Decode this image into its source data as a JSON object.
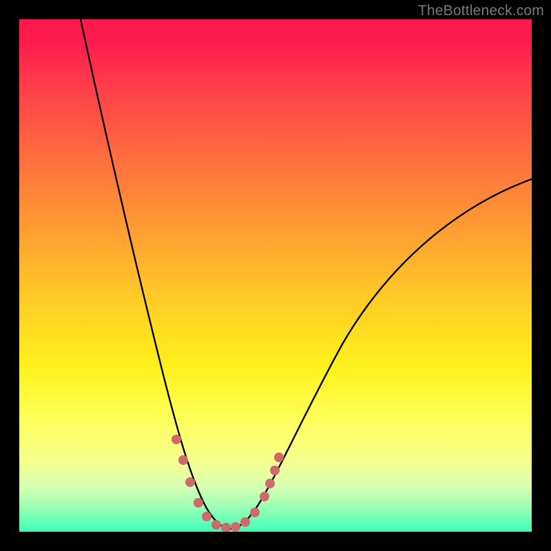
{
  "watermark": "TheBottleneck.com",
  "curve_color": "#000000",
  "marker_color": "#cf6a6a",
  "chart_data": {
    "type": "line",
    "title": "",
    "xlabel": "",
    "ylabel": "",
    "xlim": [
      0,
      100
    ],
    "ylim": [
      0,
      100
    ],
    "grid": false,
    "legend": false,
    "series": [
      {
        "name": "bottleneck-curve-left",
        "x": [
          12,
          14,
          16,
          18,
          20,
          22,
          24,
          26,
          28,
          30,
          31,
          32,
          33,
          34,
          35,
          36
        ],
        "y": [
          100,
          92,
          83,
          74,
          65,
          56,
          47,
          38,
          29,
          20,
          16,
          12,
          9,
          6,
          4,
          2
        ]
      },
      {
        "name": "bottleneck-curve-valley",
        "x": [
          36,
          37,
          38,
          39,
          40,
          41,
          42,
          43,
          44,
          45
        ],
        "y": [
          2,
          1,
          0.5,
          0.3,
          0.2,
          0.2,
          0.3,
          0.5,
          1,
          2
        ]
      },
      {
        "name": "bottleneck-curve-right",
        "x": [
          45,
          48,
          52,
          56,
          60,
          65,
          70,
          75,
          80,
          85,
          90,
          95,
          100
        ],
        "y": [
          2,
          5,
          10,
          16,
          23,
          32,
          40,
          47,
          53,
          58,
          63,
          66,
          69
        ]
      },
      {
        "name": "marker-dots",
        "type": "scatter",
        "x": [
          30.5,
          32,
          33.5,
          36,
          38,
          40,
          42,
          44,
          46,
          47.5,
          48.5,
          49.5
        ],
        "y": [
          18,
          13,
          9,
          4,
          2.5,
          2,
          2,
          2.5,
          4,
          6,
          9,
          12
        ]
      }
    ],
    "annotations": [
      {
        "text": "TheBottleneck.com",
        "pos": "top-right"
      }
    ]
  }
}
